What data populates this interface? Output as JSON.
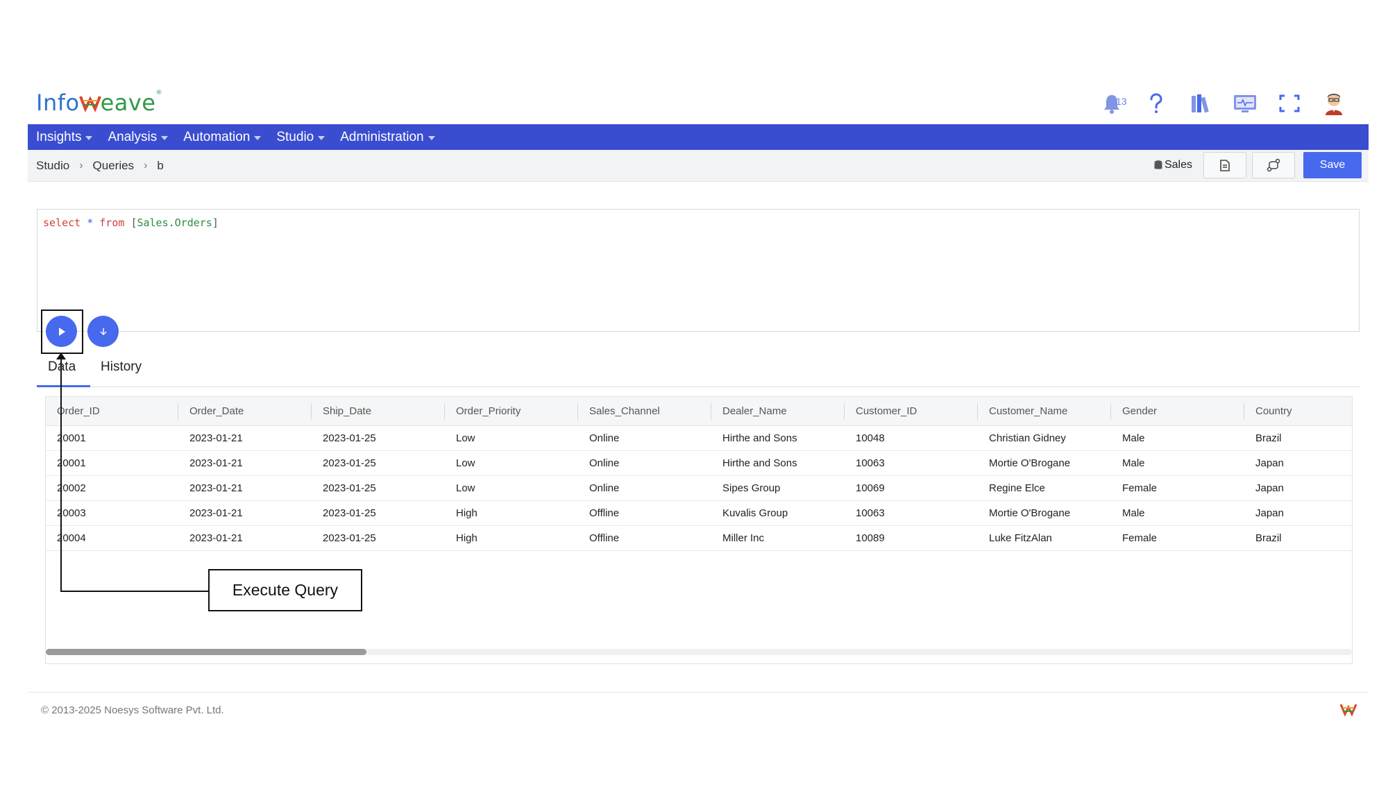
{
  "brand": {
    "logo_left": "Info",
    "logo_right": "eave",
    "registered": "®"
  },
  "header": {
    "notification_count": "13"
  },
  "menu": [
    {
      "label": "Insights"
    },
    {
      "label": "Analysis"
    },
    {
      "label": "Automation"
    },
    {
      "label": "Studio"
    },
    {
      "label": "Administration"
    }
  ],
  "breadcrumb": [
    "Studio",
    "Queries",
    "b"
  ],
  "toolbar": {
    "datasource": "Sales",
    "save_label": "Save"
  },
  "editor": {
    "tokens": {
      "select": "select",
      "star": "*",
      "from": "from",
      "open": "[",
      "schema": "Sales",
      "dot": ".",
      "table": "Orders",
      "close": "]"
    }
  },
  "tabs": [
    {
      "label": "Data"
    },
    {
      "label": "History"
    }
  ],
  "grid": {
    "columns": [
      "Order_ID",
      "Order_Date",
      "Ship_Date",
      "Order_Priority",
      "Sales_Channel",
      "Dealer_Name",
      "Customer_ID",
      "Customer_Name",
      "Gender",
      "Country"
    ],
    "rows": [
      [
        "20001",
        "2023-01-21",
        "2023-01-25",
        "Low",
        "Online",
        "Hirthe and Sons",
        "10048",
        "Christian Gidney",
        "Male",
        "Brazil"
      ],
      [
        "20001",
        "2023-01-21",
        "2023-01-25",
        "Low",
        "Online",
        "Hirthe and Sons",
        "10063",
        "Mortie O'Brogane",
        "Male",
        "Japan"
      ],
      [
        "20002",
        "2023-01-21",
        "2023-01-25",
        "Low",
        "Online",
        "Sipes Group",
        "10069",
        "Regine Elce",
        "Female",
        "Japan"
      ],
      [
        "20003",
        "2023-01-21",
        "2023-01-25",
        "High",
        "Offline",
        "Kuvalis Group",
        "10063",
        "Mortie O'Brogane",
        "Male",
        "Japan"
      ],
      [
        "20004",
        "2023-01-21",
        "2023-01-25",
        "High",
        "Offline",
        "Miller Inc",
        "10089",
        "Luke FitzAlan",
        "Female",
        "Brazil"
      ]
    ]
  },
  "callout": {
    "label": "Execute Query"
  },
  "footer": {
    "copyright": "© 2013-2025 Noesys Software Pvt. Ltd."
  },
  "colors": {
    "primary": "#3a4dd0",
    "accent": "#4769ee",
    "keyword": "#d0423b",
    "identifier": "#2c8a3f"
  },
  "icons": {
    "header": [
      "bell-icon",
      "help-icon",
      "library-icon",
      "monitor-icon",
      "fullscreen-icon",
      "avatar"
    ],
    "toolbar": [
      "database-icon",
      "document-icon",
      "connector-icon"
    ],
    "run": "play-icon",
    "more": "chevron-down-icon"
  }
}
